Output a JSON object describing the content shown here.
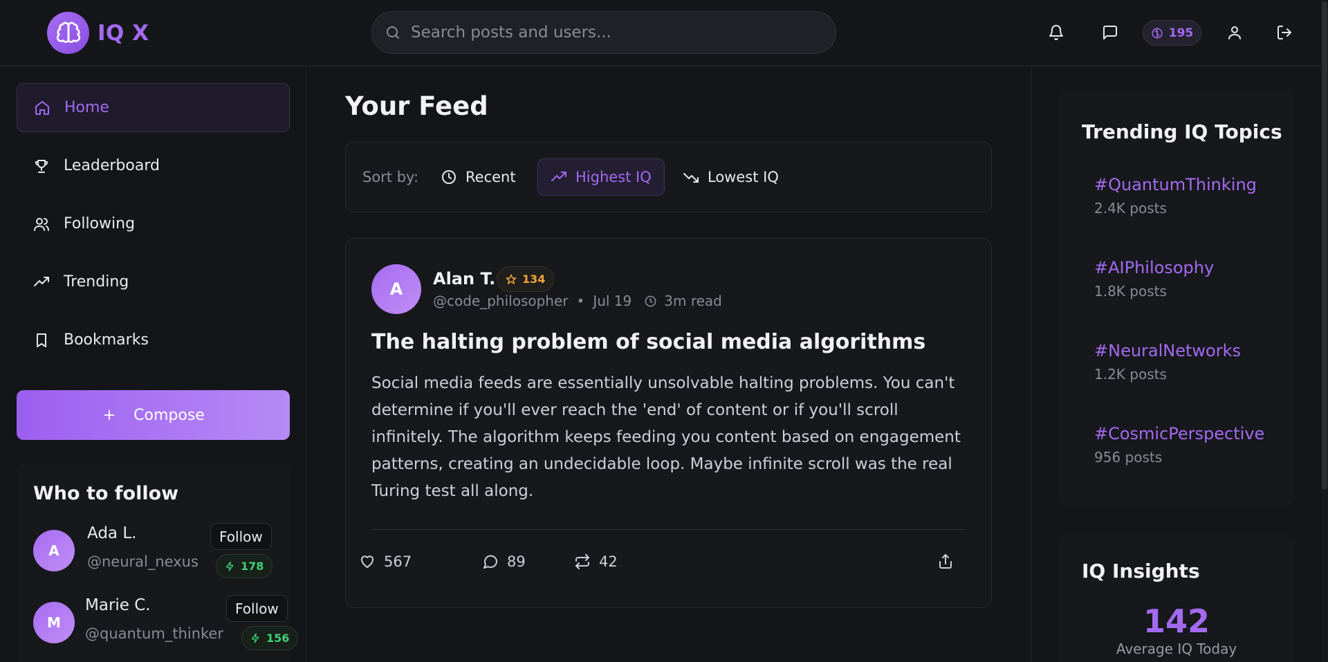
{
  "app": {
    "name": "IQ X",
    "accent_color": "#a36af0"
  },
  "header": {
    "search_placeholder": "Search posts and users...",
    "iq_score": "195",
    "icons": [
      "bell-icon",
      "message-icon",
      "brain-icon",
      "user-icon",
      "logout-icon"
    ]
  },
  "sidebar": {
    "nav": [
      {
        "label": "Home",
        "icon": "home-icon",
        "active": true
      },
      {
        "label": "Leaderboard",
        "icon": "trophy-icon",
        "active": false
      },
      {
        "label": "Following",
        "icon": "users-icon",
        "active": false
      },
      {
        "label": "Trending",
        "icon": "trending-up-icon",
        "active": false
      },
      {
        "label": "Bookmarks",
        "icon": "bookmark-icon",
        "active": false
      }
    ],
    "compose_label": "Compose",
    "who_to_follow": {
      "title": "Who to follow",
      "users": [
        {
          "initial": "A",
          "name": "Ada L.",
          "handle": "@neural_nexus",
          "iq": "178",
          "follow_label": "Follow"
        },
        {
          "initial": "M",
          "name": "Marie C.",
          "handle": "@quantum_thinker",
          "iq": "156",
          "follow_label": "Follow"
        }
      ]
    }
  },
  "feed": {
    "title": "Your Feed",
    "sort": {
      "label": "Sort by:",
      "options": [
        {
          "label": "Recent",
          "icon": "clock-icon",
          "active": false
        },
        {
          "label": "Highest IQ",
          "icon": "trending-up-icon",
          "active": true
        },
        {
          "label": "Lowest IQ",
          "icon": "trending-down-icon",
          "active": false
        }
      ]
    },
    "posts": [
      {
        "initial": "A",
        "author": "Alan T.",
        "iq": "134",
        "handle": "@code_philosopher",
        "separator": "•",
        "date": "Jul 19",
        "read_time": "3m read",
        "title": "The halting problem of social media algorithms",
        "body": "Social media feeds are essentially unsolvable halting problems. You can't determine if you'll ever reach the 'end' of content or if you'll scroll infinitely. The algorithm keeps feeding you content based on engagement patterns, creating an undecidable loop. Maybe infinite scroll was the real Turing test all along.",
        "likes": "567",
        "comments": "89",
        "reposts": "42"
      }
    ]
  },
  "trending": {
    "title": "Trending IQ Topics",
    "topics": [
      {
        "tag": "#QuantumThinking",
        "count": "2.4K posts"
      },
      {
        "tag": "#AIPhilosophy",
        "count": "1.8K posts"
      },
      {
        "tag": "#NeuralNetworks",
        "count": "1.2K posts"
      },
      {
        "tag": "#CosmicPerspective",
        "count": "956 posts"
      }
    ]
  },
  "insights": {
    "title": "IQ Insights",
    "value": "142",
    "label": "Average IQ Today"
  }
}
